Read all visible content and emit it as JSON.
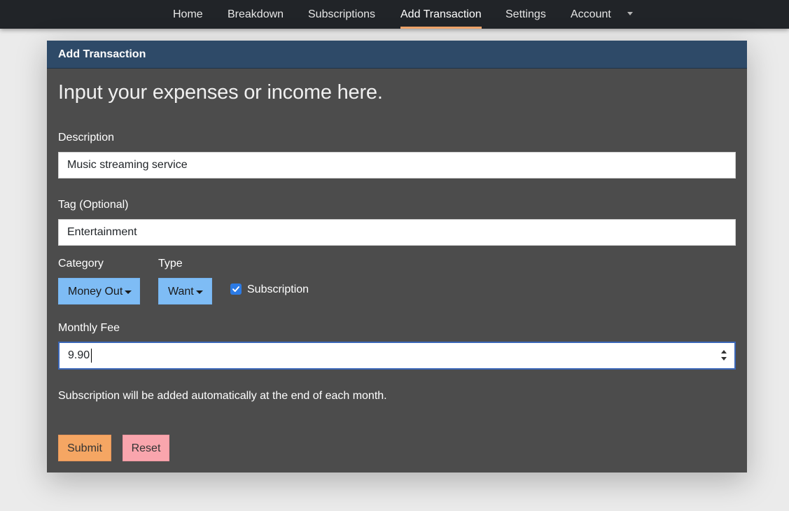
{
  "nav": {
    "items": [
      {
        "label": "Home"
      },
      {
        "label": "Breakdown"
      },
      {
        "label": "Subscriptions"
      },
      {
        "label": "Add Transaction",
        "active": true
      },
      {
        "label": "Settings"
      },
      {
        "label": "Account"
      }
    ],
    "accent_color": "#f2a66b"
  },
  "card": {
    "header": "Add Transaction",
    "lead": "Input your expenses or income here."
  },
  "form": {
    "description": {
      "label": "Description",
      "value": "Music streaming service"
    },
    "tag": {
      "label": "Tag (Optional)",
      "value": "Entertainment"
    },
    "category": {
      "label": "Category",
      "selected": "Money Out"
    },
    "type": {
      "label": "Type",
      "selected": "Want"
    },
    "subscription": {
      "label": "Subscription",
      "checked": true
    },
    "monthly_fee": {
      "label": "Monthly Fee",
      "value": "9.90"
    },
    "help_text": "Subscription will be added automatically at the end of each month.",
    "submit_label": "Submit",
    "reset_label": "Reset"
  },
  "colors": {
    "navbar": "#212428",
    "card_header": "#2e4a68",
    "card_body": "#4c4c4c",
    "dropdown": "#7ebcf5",
    "submit": "#f5a663",
    "reset": "#f9a5ad",
    "checkbox": "#2c7be5"
  }
}
